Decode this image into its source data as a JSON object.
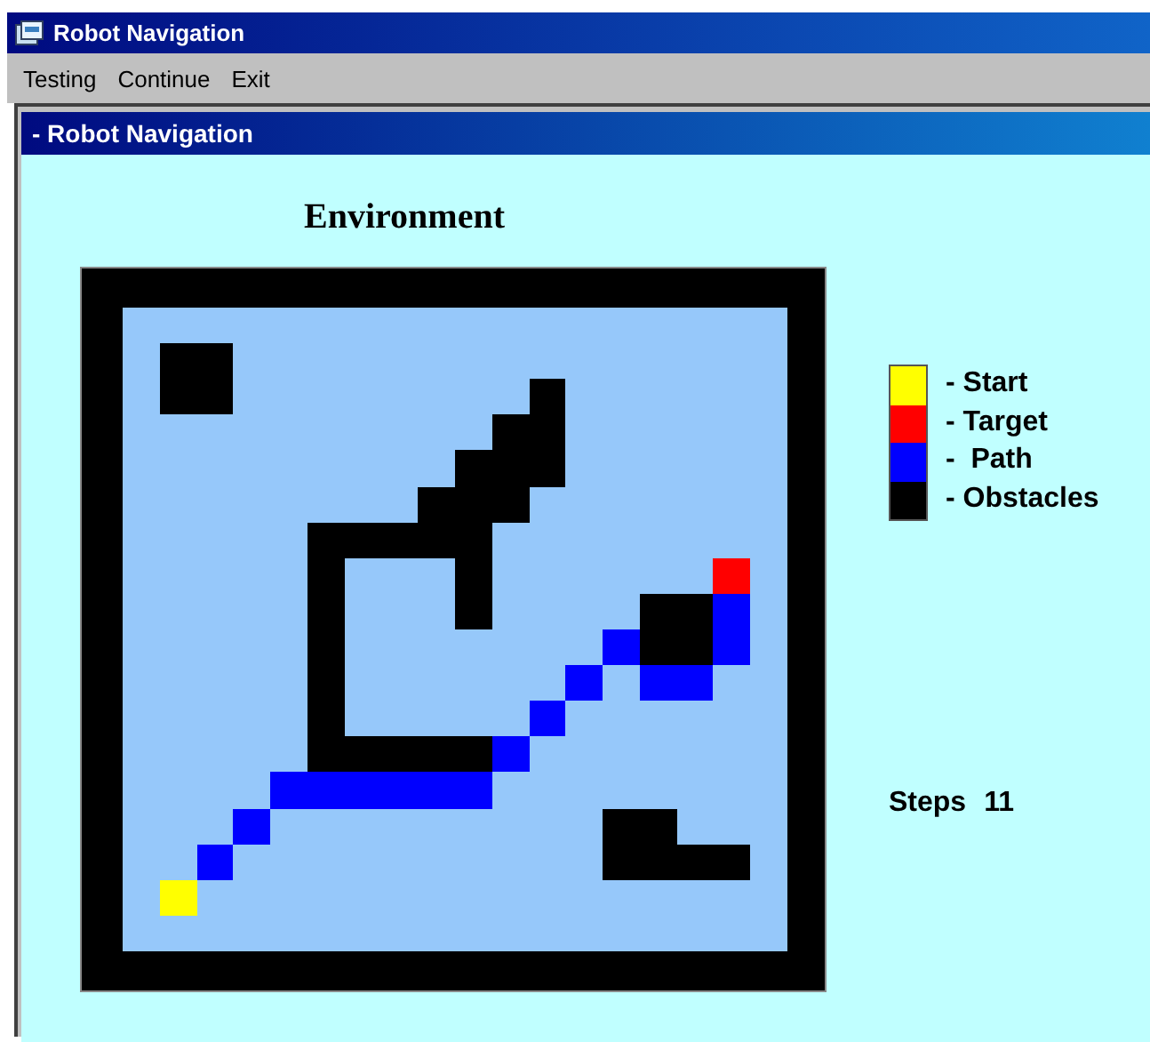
{
  "window": {
    "title": "Robot Navigation"
  },
  "menu": [
    "Testing",
    "Continue",
    "Exit"
  ],
  "child_window": {
    "title": "- Robot Navigation"
  },
  "environment": {
    "title": "Environment",
    "grid": [
      {
        "cells": [
          {
            "kind": "empty"
          },
          {
            "kind": "empty"
          },
          {
            "kind": "empty"
          },
          {
            "kind": "empty"
          },
          {
            "kind": "empty"
          },
          {
            "kind": "empty"
          },
          {
            "kind": "empty"
          },
          {
            "kind": "empty"
          },
          {
            "kind": "empty"
          },
          {
            "kind": "empty"
          },
          {
            "kind": "empty"
          },
          {
            "kind": "empty"
          },
          {
            "kind": "empty"
          },
          {
            "kind": "empty"
          },
          {
            "kind": "empty"
          },
          {
            "kind": "empty"
          },
          {
            "kind": "empty"
          },
          {
            "kind": "empty"
          }
        ]
      },
      {
        "cells": [
          {
            "kind": "empty"
          },
          {
            "kind": "obstacle"
          },
          {
            "kind": "obstacle"
          },
          {
            "kind": "empty"
          },
          {
            "kind": "empty"
          },
          {
            "kind": "empty"
          },
          {
            "kind": "empty"
          },
          {
            "kind": "empty"
          },
          {
            "kind": "empty"
          },
          {
            "kind": "empty"
          },
          {
            "kind": "empty"
          },
          {
            "kind": "empty"
          },
          {
            "kind": "empty"
          },
          {
            "kind": "empty"
          },
          {
            "kind": "empty"
          },
          {
            "kind": "empty"
          },
          {
            "kind": "empty"
          },
          {
            "kind": "empty"
          }
        ]
      },
      {
        "cells": [
          {
            "kind": "empty"
          },
          {
            "kind": "obstacle"
          },
          {
            "kind": "obstacle"
          },
          {
            "kind": "empty"
          },
          {
            "kind": "empty"
          },
          {
            "kind": "empty"
          },
          {
            "kind": "empty"
          },
          {
            "kind": "empty"
          },
          {
            "kind": "empty"
          },
          {
            "kind": "empty"
          },
          {
            "kind": "empty"
          },
          {
            "kind": "obstacle"
          },
          {
            "kind": "empty"
          },
          {
            "kind": "empty"
          },
          {
            "kind": "empty"
          },
          {
            "kind": "empty"
          },
          {
            "kind": "empty"
          },
          {
            "kind": "empty"
          }
        ]
      },
      {
        "cells": [
          {
            "kind": "empty"
          },
          {
            "kind": "empty"
          },
          {
            "kind": "empty"
          },
          {
            "kind": "empty"
          },
          {
            "kind": "empty"
          },
          {
            "kind": "empty"
          },
          {
            "kind": "empty"
          },
          {
            "kind": "empty"
          },
          {
            "kind": "empty"
          },
          {
            "kind": "empty"
          },
          {
            "kind": "obstacle"
          },
          {
            "kind": "obstacle"
          },
          {
            "kind": "empty"
          },
          {
            "kind": "empty"
          },
          {
            "kind": "empty"
          },
          {
            "kind": "empty"
          },
          {
            "kind": "empty"
          },
          {
            "kind": "empty"
          }
        ]
      },
      {
        "cells": [
          {
            "kind": "empty"
          },
          {
            "kind": "empty"
          },
          {
            "kind": "empty"
          },
          {
            "kind": "empty"
          },
          {
            "kind": "empty"
          },
          {
            "kind": "empty"
          },
          {
            "kind": "empty"
          },
          {
            "kind": "empty"
          },
          {
            "kind": "empty"
          },
          {
            "kind": "obstacle"
          },
          {
            "kind": "obstacle"
          },
          {
            "kind": "obstacle"
          },
          {
            "kind": "empty"
          },
          {
            "kind": "empty"
          },
          {
            "kind": "empty"
          },
          {
            "kind": "empty"
          },
          {
            "kind": "empty"
          },
          {
            "kind": "empty"
          }
        ]
      },
      {
        "cells": [
          {
            "kind": "empty"
          },
          {
            "kind": "empty"
          },
          {
            "kind": "empty"
          },
          {
            "kind": "empty"
          },
          {
            "kind": "empty"
          },
          {
            "kind": "empty"
          },
          {
            "kind": "empty"
          },
          {
            "kind": "empty"
          },
          {
            "kind": "obstacle"
          },
          {
            "kind": "obstacle"
          },
          {
            "kind": "obstacle"
          },
          {
            "kind": "empty"
          },
          {
            "kind": "empty"
          },
          {
            "kind": "empty"
          },
          {
            "kind": "empty"
          },
          {
            "kind": "empty"
          },
          {
            "kind": "empty"
          },
          {
            "kind": "empty"
          }
        ]
      },
      {
        "cells": [
          {
            "kind": "empty"
          },
          {
            "kind": "empty"
          },
          {
            "kind": "empty"
          },
          {
            "kind": "empty"
          },
          {
            "kind": "empty"
          },
          {
            "kind": "obstacle"
          },
          {
            "kind": "obstacle"
          },
          {
            "kind": "obstacle"
          },
          {
            "kind": "obstacle"
          },
          {
            "kind": "obstacle"
          },
          {
            "kind": "empty"
          },
          {
            "kind": "empty"
          },
          {
            "kind": "empty"
          },
          {
            "kind": "empty"
          },
          {
            "kind": "empty"
          },
          {
            "kind": "empty"
          },
          {
            "kind": "empty"
          },
          {
            "kind": "empty"
          }
        ]
      },
      {
        "cells": [
          {
            "kind": "empty"
          },
          {
            "kind": "empty"
          },
          {
            "kind": "empty"
          },
          {
            "kind": "empty"
          },
          {
            "kind": "empty"
          },
          {
            "kind": "obstacle"
          },
          {
            "kind": "empty"
          },
          {
            "kind": "empty"
          },
          {
            "kind": "empty"
          },
          {
            "kind": "obstacle"
          },
          {
            "kind": "empty"
          },
          {
            "kind": "empty"
          },
          {
            "kind": "empty"
          },
          {
            "kind": "empty"
          },
          {
            "kind": "empty"
          },
          {
            "kind": "empty"
          },
          {
            "kind": "target"
          },
          {
            "kind": "empty"
          }
        ]
      },
      {
        "cells": [
          {
            "kind": "empty"
          },
          {
            "kind": "empty"
          },
          {
            "kind": "empty"
          },
          {
            "kind": "empty"
          },
          {
            "kind": "empty"
          },
          {
            "kind": "obstacle"
          },
          {
            "kind": "empty"
          },
          {
            "kind": "empty"
          },
          {
            "kind": "empty"
          },
          {
            "kind": "obstacle"
          },
          {
            "kind": "empty"
          },
          {
            "kind": "empty"
          },
          {
            "kind": "empty"
          },
          {
            "kind": "empty"
          },
          {
            "kind": "obstacle"
          },
          {
            "kind": "obstacle"
          },
          {
            "kind": "path"
          },
          {
            "kind": "empty"
          }
        ]
      },
      {
        "cells": [
          {
            "kind": "empty"
          },
          {
            "kind": "empty"
          },
          {
            "kind": "empty"
          },
          {
            "kind": "empty"
          },
          {
            "kind": "empty"
          },
          {
            "kind": "obstacle"
          },
          {
            "kind": "empty"
          },
          {
            "kind": "empty"
          },
          {
            "kind": "empty"
          },
          {
            "kind": "empty"
          },
          {
            "kind": "empty"
          },
          {
            "kind": "empty"
          },
          {
            "kind": "empty"
          },
          {
            "kind": "path"
          },
          {
            "kind": "obstacle"
          },
          {
            "kind": "obstacle"
          },
          {
            "kind": "path"
          },
          {
            "kind": "empty"
          }
        ]
      },
      {
        "cells": [
          {
            "kind": "empty"
          },
          {
            "kind": "empty"
          },
          {
            "kind": "empty"
          },
          {
            "kind": "empty"
          },
          {
            "kind": "empty"
          },
          {
            "kind": "obstacle"
          },
          {
            "kind": "empty"
          },
          {
            "kind": "empty"
          },
          {
            "kind": "empty"
          },
          {
            "kind": "empty"
          },
          {
            "kind": "empty"
          },
          {
            "kind": "empty"
          },
          {
            "kind": "path"
          },
          {
            "kind": "empty"
          },
          {
            "kind": "path"
          },
          {
            "kind": "path"
          },
          {
            "kind": "empty"
          },
          {
            "kind": "empty"
          }
        ]
      },
      {
        "cells": [
          {
            "kind": "empty"
          },
          {
            "kind": "empty"
          },
          {
            "kind": "empty"
          },
          {
            "kind": "empty"
          },
          {
            "kind": "empty"
          },
          {
            "kind": "obstacle"
          },
          {
            "kind": "empty"
          },
          {
            "kind": "empty"
          },
          {
            "kind": "empty"
          },
          {
            "kind": "empty"
          },
          {
            "kind": "empty"
          },
          {
            "kind": "path"
          },
          {
            "kind": "empty"
          },
          {
            "kind": "empty"
          },
          {
            "kind": "empty"
          },
          {
            "kind": "empty"
          },
          {
            "kind": "empty"
          },
          {
            "kind": "empty"
          }
        ]
      },
      {
        "cells": [
          {
            "kind": "empty"
          },
          {
            "kind": "empty"
          },
          {
            "kind": "empty"
          },
          {
            "kind": "empty"
          },
          {
            "kind": "empty"
          },
          {
            "kind": "obstacle"
          },
          {
            "kind": "obstacle"
          },
          {
            "kind": "obstacle"
          },
          {
            "kind": "obstacle"
          },
          {
            "kind": "obstacle"
          },
          {
            "kind": "path"
          },
          {
            "kind": "empty"
          },
          {
            "kind": "empty"
          },
          {
            "kind": "empty"
          },
          {
            "kind": "empty"
          },
          {
            "kind": "empty"
          },
          {
            "kind": "empty"
          },
          {
            "kind": "empty"
          }
        ]
      },
      {
        "cells": [
          {
            "kind": "empty"
          },
          {
            "kind": "empty"
          },
          {
            "kind": "empty"
          },
          {
            "kind": "empty"
          },
          {
            "kind": "path"
          },
          {
            "kind": "path"
          },
          {
            "kind": "path"
          },
          {
            "kind": "path"
          },
          {
            "kind": "path"
          },
          {
            "kind": "path"
          },
          {
            "kind": "empty"
          },
          {
            "kind": "empty"
          },
          {
            "kind": "empty"
          },
          {
            "kind": "empty"
          },
          {
            "kind": "empty"
          },
          {
            "kind": "empty"
          },
          {
            "kind": "empty"
          },
          {
            "kind": "empty"
          }
        ]
      },
      {
        "cells": [
          {
            "kind": "empty"
          },
          {
            "kind": "empty"
          },
          {
            "kind": "empty"
          },
          {
            "kind": "path"
          },
          {
            "kind": "empty"
          },
          {
            "kind": "empty"
          },
          {
            "kind": "empty"
          },
          {
            "kind": "empty"
          },
          {
            "kind": "empty"
          },
          {
            "kind": "empty"
          },
          {
            "kind": "empty"
          },
          {
            "kind": "empty"
          },
          {
            "kind": "empty"
          },
          {
            "kind": "obstacle"
          },
          {
            "kind": "obstacle"
          },
          {
            "kind": "empty"
          },
          {
            "kind": "empty"
          },
          {
            "kind": "empty"
          }
        ]
      },
      {
        "cells": [
          {
            "kind": "empty"
          },
          {
            "kind": "empty"
          },
          {
            "kind": "path"
          },
          {
            "kind": "empty"
          },
          {
            "kind": "empty"
          },
          {
            "kind": "empty"
          },
          {
            "kind": "empty"
          },
          {
            "kind": "empty"
          },
          {
            "kind": "empty"
          },
          {
            "kind": "empty"
          },
          {
            "kind": "empty"
          },
          {
            "kind": "empty"
          },
          {
            "kind": "empty"
          },
          {
            "kind": "obstacle"
          },
          {
            "kind": "obstacle"
          },
          {
            "kind": "obstacle"
          },
          {
            "kind": "obstacle"
          },
          {
            "kind": "empty"
          }
        ]
      },
      {
        "cells": [
          {
            "kind": "empty"
          },
          {
            "kind": "start"
          },
          {
            "kind": "empty"
          },
          {
            "kind": "empty"
          },
          {
            "kind": "empty"
          },
          {
            "kind": "empty"
          },
          {
            "kind": "empty"
          },
          {
            "kind": "empty"
          },
          {
            "kind": "empty"
          },
          {
            "kind": "empty"
          },
          {
            "kind": "empty"
          },
          {
            "kind": "empty"
          },
          {
            "kind": "empty"
          },
          {
            "kind": "empty"
          },
          {
            "kind": "empty"
          },
          {
            "kind": "empty"
          },
          {
            "kind": "empty"
          },
          {
            "kind": "empty"
          }
        ]
      },
      {
        "cells": [
          {
            "kind": "empty"
          },
          {
            "kind": "empty"
          },
          {
            "kind": "empty"
          },
          {
            "kind": "empty"
          },
          {
            "kind": "empty"
          },
          {
            "kind": "empty"
          },
          {
            "kind": "empty"
          },
          {
            "kind": "empty"
          },
          {
            "kind": "empty"
          },
          {
            "kind": "empty"
          },
          {
            "kind": "empty"
          },
          {
            "kind": "empty"
          },
          {
            "kind": "empty"
          },
          {
            "kind": "empty"
          },
          {
            "kind": "empty"
          },
          {
            "kind": "empty"
          },
          {
            "kind": "empty"
          },
          {
            "kind": "empty"
          }
        ]
      }
    ]
  },
  "legend": [
    {
      "label": "- Start",
      "color": "#ffff00"
    },
    {
      "label": "- Target",
      "color": "#ff0000"
    },
    {
      "label": "-  Path",
      "color": "#0000ff"
    },
    {
      "label": "- Obstacles",
      "color": "#000000"
    }
  ],
  "steps": {
    "label": "Steps",
    "value": "11"
  }
}
